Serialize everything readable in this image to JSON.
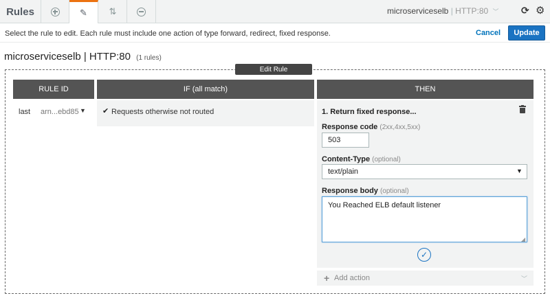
{
  "tabs": {
    "rules_label": "Rules"
  },
  "header": {
    "load_balancer": "microserviceselb",
    "separator": "|",
    "port": "HTTP:80"
  },
  "infobar": {
    "message": "Select the rule to edit. Each rule must include one action of type forward, redirect, fixed response.",
    "cancel_label": "Cancel",
    "update_label": "Update"
  },
  "listener": {
    "title": "microserviceselb | HTTP:80",
    "rule_count": "(1 rules)"
  },
  "edit_rule_label": "Edit Rule",
  "columns": {
    "rule_id": "RULE ID",
    "if": "IF (all match)",
    "then": "THEN"
  },
  "rule": {
    "priority": "last",
    "arn": "arn...ebd85",
    "condition": "Requests otherwise not routed"
  },
  "action": {
    "title": "1. Return fixed response...",
    "response_code_label": "Response code",
    "response_code_hint": "(2xx,4xx,5xx)",
    "response_code": "503",
    "content_type_label": "Content-Type",
    "content_type_hint": "(optional)",
    "content_type": "text/plain",
    "response_body_label": "Response body",
    "response_body_hint": "(optional)",
    "response_body": "You Reached ELB default listener"
  },
  "add_action_label": "Add action",
  "colors": {
    "accent": "#ec7211",
    "primary_button": "#1a73c2",
    "link": "#0073bb",
    "column_header": "#545454"
  }
}
